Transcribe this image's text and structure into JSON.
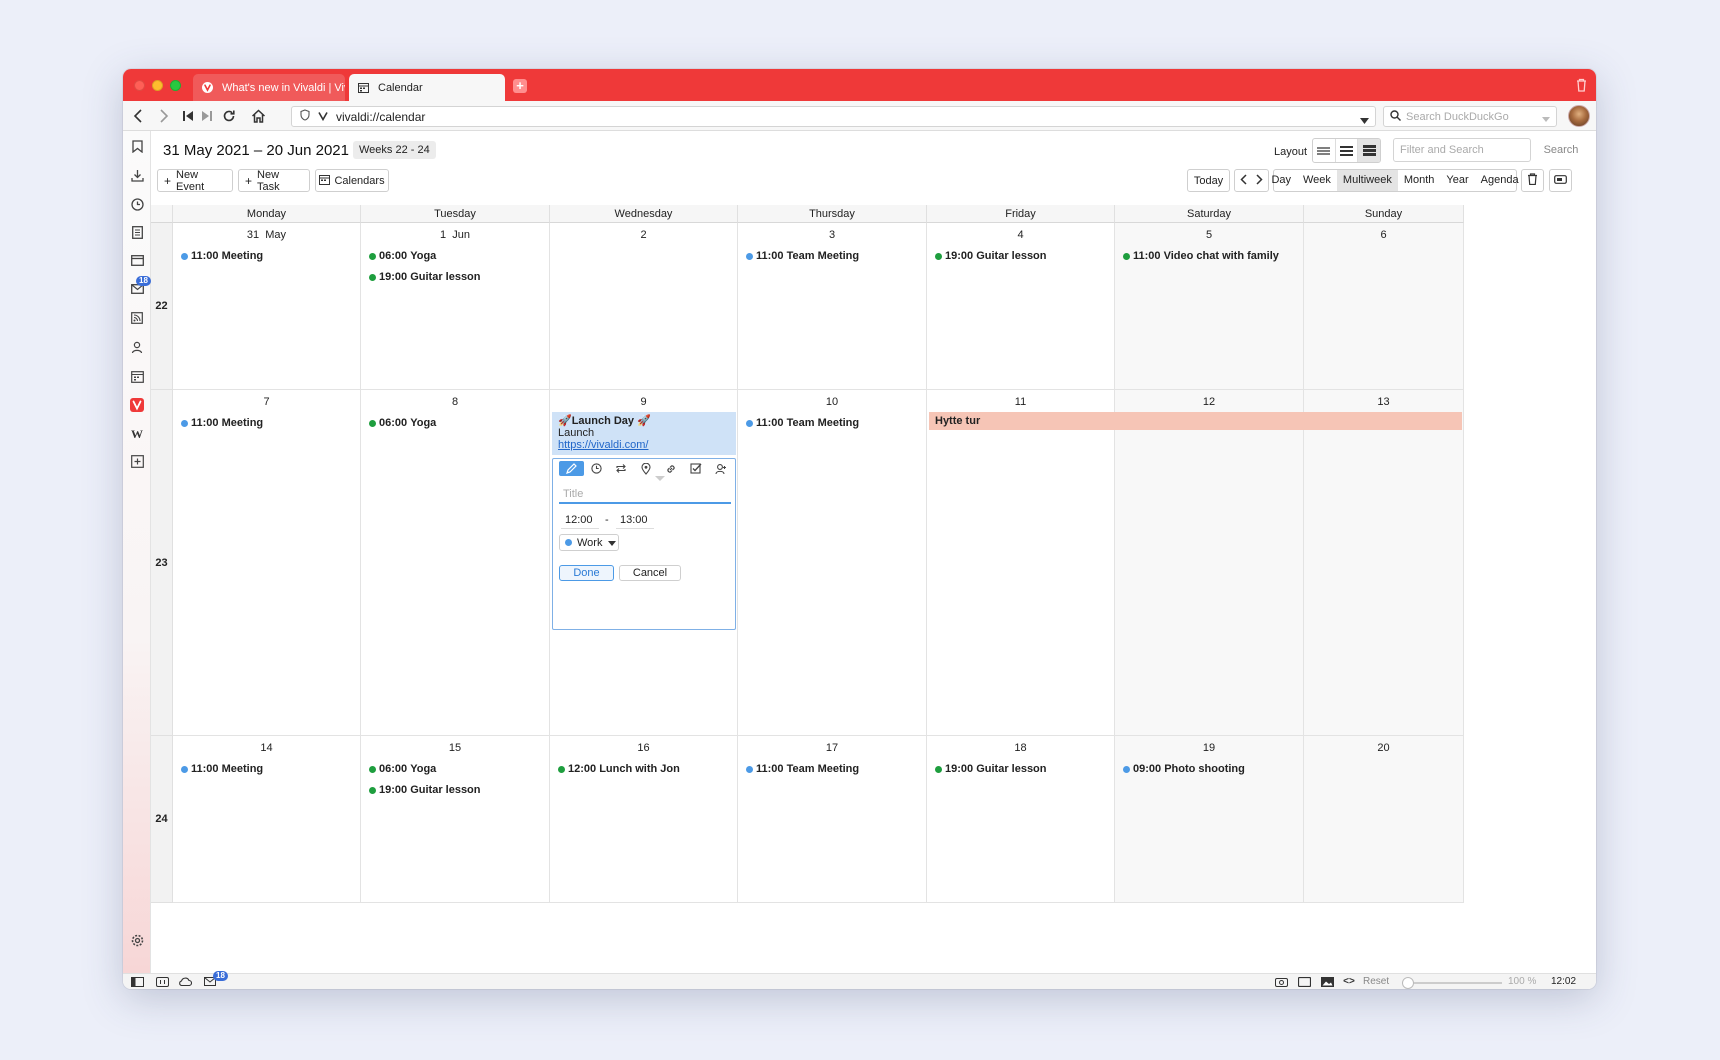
{
  "tabs": [
    {
      "label": "What's new in Vivaldi | Viv"
    },
    {
      "label": "Calendar"
    }
  ],
  "address": {
    "url": "vivaldi://calendar",
    "search_placeholder": "Search DuckDuckGo"
  },
  "sidebar": {
    "mail_badge": "18"
  },
  "calendar": {
    "range_title": "31 May 2021 – 20 Jun 2021",
    "weeks_label": "Weeks 22 - 24",
    "layout_label": "Layout",
    "filter_placeholder": "Filter and Search",
    "search_label": "Search",
    "new_event": "New Event",
    "new_task": "New Task",
    "calendars": "Calendars",
    "today": "Today",
    "views": [
      "Day",
      "Week",
      "Multiweek",
      "Month",
      "Year",
      "Agenda"
    ],
    "active_view": "Multiweek",
    "day_headers": [
      "Monday",
      "Tuesday",
      "Wednesday",
      "Thursday",
      "Friday",
      "Saturday",
      "Sunday"
    ],
    "weeks": [
      {
        "number": "22",
        "days": [
          {
            "label": "31  May",
            "events": [
              {
                "time": "11:00",
                "title": "Meeting",
                "color": "blue"
              }
            ]
          },
          {
            "label": "1  Jun",
            "events": [
              {
                "time": "06:00",
                "title": "Yoga",
                "color": "green"
              },
              {
                "time": "19:00",
                "title": "Guitar lesson",
                "color": "green"
              }
            ]
          },
          {
            "label": "2",
            "events": []
          },
          {
            "label": "3",
            "events": [
              {
                "time": "11:00",
                "title": "Team Meeting",
                "color": "blue"
              }
            ]
          },
          {
            "label": "4",
            "events": [
              {
                "time": "19:00",
                "title": "Guitar lesson",
                "color": "green"
              }
            ]
          },
          {
            "label": "5",
            "events": [
              {
                "time": "11:00",
                "title": "Video chat with family",
                "color": "green"
              }
            ]
          },
          {
            "label": "6",
            "events": []
          }
        ]
      },
      {
        "number": "23",
        "days": [
          {
            "label": "7",
            "events": [
              {
                "time": "11:00",
                "title": "Meeting",
                "color": "blue"
              }
            ]
          },
          {
            "label": "8",
            "events": [
              {
                "time": "06:00",
                "title": "Yoga",
                "color": "green"
              }
            ]
          },
          {
            "label": "9",
            "events": []
          },
          {
            "label": "10",
            "events": [
              {
                "time": "11:00",
                "title": "Team Meeting",
                "color": "blue"
              }
            ]
          },
          {
            "label": "11",
            "events": []
          },
          {
            "label": "12",
            "events": []
          },
          {
            "label": "13",
            "events": []
          }
        ]
      },
      {
        "number": "24",
        "days": [
          {
            "label": "14",
            "events": [
              {
                "time": "11:00",
                "title": "Meeting",
                "color": "blue"
              }
            ]
          },
          {
            "label": "15",
            "events": [
              {
                "time": "06:00",
                "title": "Yoga",
                "color": "green"
              },
              {
                "time": "19:00",
                "title": "Guitar lesson",
                "color": "green"
              }
            ]
          },
          {
            "label": "16",
            "events": [
              {
                "time": "12:00",
                "title": "Lunch with Jon",
                "color": "green"
              }
            ]
          },
          {
            "label": "17",
            "events": [
              {
                "time": "11:00",
                "title": "Team Meeting",
                "color": "blue"
              }
            ]
          },
          {
            "label": "18",
            "events": [
              {
                "time": "19:00",
                "title": "Guitar lesson",
                "color": "green"
              }
            ]
          },
          {
            "label": "19",
            "events": [
              {
                "time": "09:00",
                "title": "Photo shooting",
                "color": "blue"
              }
            ]
          },
          {
            "label": "20",
            "events": []
          }
        ]
      }
    ],
    "launch_event": {
      "title": "🚀Launch Day 🚀",
      "subtitle": "Launch",
      "link": "https://vivaldi.com/"
    },
    "multiday_event": {
      "title": "Hytte tur"
    },
    "editor": {
      "title_placeholder": "Title",
      "start_time": "12:00",
      "separator": "-",
      "end_time": "13:00",
      "calendar": "Work",
      "done": "Done",
      "cancel": "Cancel"
    }
  },
  "statusbar": {
    "mail_badge": "18",
    "reset": "Reset",
    "zoom": "100 %",
    "clock": "12:02"
  },
  "colors": {
    "accent": "#ef3939",
    "event_blue": "#4c9ae6",
    "event_green": "#1e9e3e",
    "launch_bg": "#cfe2f7",
    "hytte_bg": "#f6c5b6"
  }
}
